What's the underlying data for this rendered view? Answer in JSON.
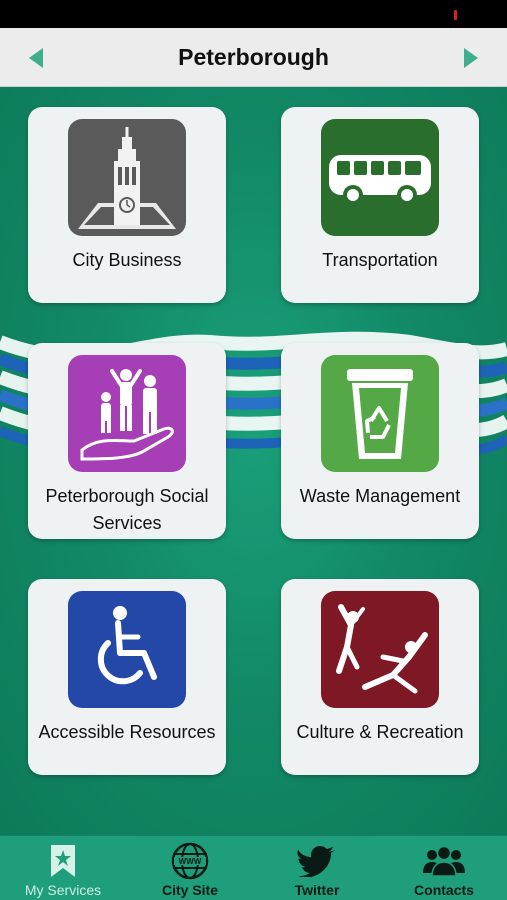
{
  "header": {
    "title": "Peterborough"
  },
  "services": [
    {
      "label": "City Business",
      "icon": "city-hall-icon",
      "color": "#5a5a5a"
    },
    {
      "label": "Transportation",
      "icon": "bus-icon",
      "color": "#2a6e2e"
    },
    {
      "label": "Peterborough Social Services",
      "icon": "family-hand-icon",
      "color": "#a63eb5"
    },
    {
      "label": "Waste Management",
      "icon": "recycle-bin-icon",
      "color": "#54a845"
    },
    {
      "label": "Accessible Resources",
      "icon": "wheelchair-icon",
      "color": "#2448a8"
    },
    {
      "label": "Culture & Recreation",
      "icon": "dancers-icon",
      "color": "#7d1824"
    }
  ],
  "tabbar": {
    "tabs": [
      {
        "label": "My Services",
        "icon": "bookmark-star-icon",
        "active": true
      },
      {
        "label": "City Site",
        "icon": "globe-www-icon",
        "active": false
      },
      {
        "label": "Twitter",
        "icon": "twitter-bird-icon",
        "active": false
      },
      {
        "label": "Contacts",
        "icon": "people-icon",
        "active": false
      }
    ]
  },
  "colors": {
    "background": "#128a67",
    "tabbar": "#1f9e7b",
    "header": "#ececec",
    "arrow": "#3fae8c"
  }
}
